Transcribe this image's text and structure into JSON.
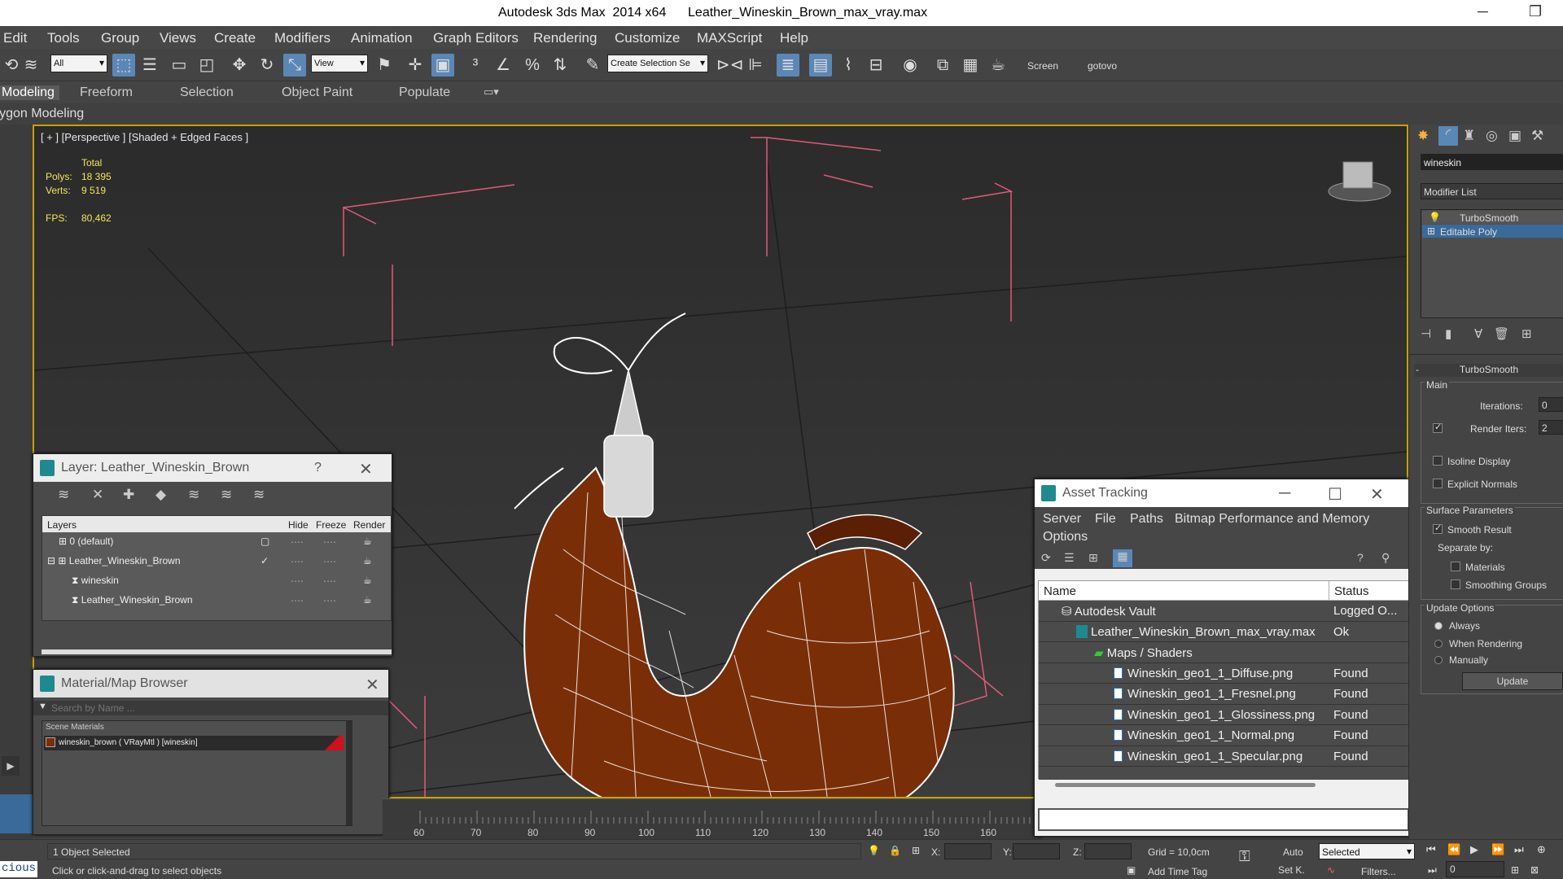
{
  "window": {
    "title": "Autodesk 3ds Max  2014 x64      Leather_Wineskin_Brown_max_vray.max"
  },
  "menu": [
    "Edit",
    "Tools",
    "Group",
    "Views",
    "Create",
    "Modifiers",
    "Animation",
    "Graph Editors",
    "Rendering",
    "Customize",
    "MAXScript",
    "Help"
  ],
  "toolbar": {
    "filter_value": "All",
    "refcoord_value": "View",
    "named_selection_placeholder": "Create Selection Se",
    "screen_label": "Screen",
    "gotovo_label": "gotovo"
  },
  "ribbon": {
    "tabs": [
      "Modeling",
      "Freeform",
      "Selection",
      "Object Paint",
      "Populate"
    ],
    "subtab": "Polygon Modeling"
  },
  "viewport": {
    "label": "[ + ] [Perspective ] [Shaded + Edged Faces ]",
    "stats": {
      "total_label": "Total",
      "polys_label": "Polys:",
      "polys_value": "18 395",
      "verts_label": "Verts:",
      "verts_value": "9 519",
      "fps_label": "FPS:",
      "fps_value": "80,462"
    }
  },
  "layer_window": {
    "title": "Layer: Leather_Wineskin_Brown",
    "help": "?",
    "columns": [
      "Layers",
      "Hide",
      "Freeze",
      "Render"
    ],
    "rows": [
      {
        "name": "0 (default)"
      },
      {
        "name": "Leather_Wineskin_Brown"
      },
      {
        "name": "wineskin"
      },
      {
        "name": "Leather_Wineskin_Brown"
      }
    ]
  },
  "material_browser": {
    "title": "Material/Map Browser",
    "search_placeholder": "Search by Name ...",
    "section": "Scene Materials",
    "item": "wineskin_brown  ( VRayMtl )  [wineskin]"
  },
  "asset_tracking": {
    "title": "Asset Tracking",
    "menu": [
      "Server",
      "File",
      "Paths",
      "Bitmap Performance and Memory",
      "Options"
    ],
    "columns": [
      "Name",
      "Status"
    ],
    "rows": [
      {
        "name": "Autodesk Vault",
        "status": "Logged O..."
      },
      {
        "name": "Leather_Wineskin_Brown_max_vray.max",
        "status": "Ok"
      },
      {
        "name": "Maps / Shaders",
        "status": ""
      },
      {
        "name": "Wineskin_geo1_1_Diffuse.png",
        "status": "Found"
      },
      {
        "name": "Wineskin_geo1_1_Fresnel.png",
        "status": "Found"
      },
      {
        "name": "Wineskin_geo1_1_Glossiness.png",
        "status": "Found"
      },
      {
        "name": "Wineskin_geo1_1_Normal.png",
        "status": "Found"
      },
      {
        "name": "Wineskin_geo1_1_Specular.png",
        "status": "Found"
      }
    ]
  },
  "command_panel": {
    "object_name": "wineskin",
    "modifier_list": "Modifier List",
    "stack": [
      "TurboSmooth",
      "Editable Poly"
    ],
    "rollout_title": "TurboSmooth",
    "main_label": "Main",
    "iterations_label": "Iterations:",
    "iterations_value": "0",
    "render_iters_label": "Render Iters:",
    "render_iters_value": "2",
    "isoline": "Isoline Display",
    "explicit": "Explicit Normals",
    "surface_label": "Surface Parameters",
    "smooth_result": "Smooth Result",
    "separate_by": "Separate by:",
    "materials": "Materials",
    "smoothing_groups": "Smoothing Groups",
    "update_options": "Update Options",
    "always": "Always",
    "when_rendering": "When Rendering",
    "manually": "Manually",
    "update_button": "Update"
  },
  "timeline": {
    "ticks": [
      "60",
      "70",
      "80",
      "90",
      "100",
      "110",
      "120",
      "130",
      "140",
      "150",
      "160"
    ]
  },
  "status": {
    "maxscript": "cious",
    "selected": "1 Object Selected",
    "prompt": "Click or click-and-drag to select objects",
    "x_label": "X:",
    "y_label": "Y:",
    "z_label": "Z:",
    "grid": "Grid = 10,0cm",
    "add_time_tag": "Add Time Tag",
    "auto": "Auto",
    "setk": "Set K.",
    "selected_dropdown": "Selected",
    "filters": "Filters...",
    "frame_value": "0"
  },
  "colors": {
    "accent": "#5b87b7",
    "viewport_border": "#c8a000",
    "stats": "#f2e65a",
    "mesh": "#7a2e08",
    "wire": "#ffffff",
    "bbox": "#e05a7a"
  }
}
